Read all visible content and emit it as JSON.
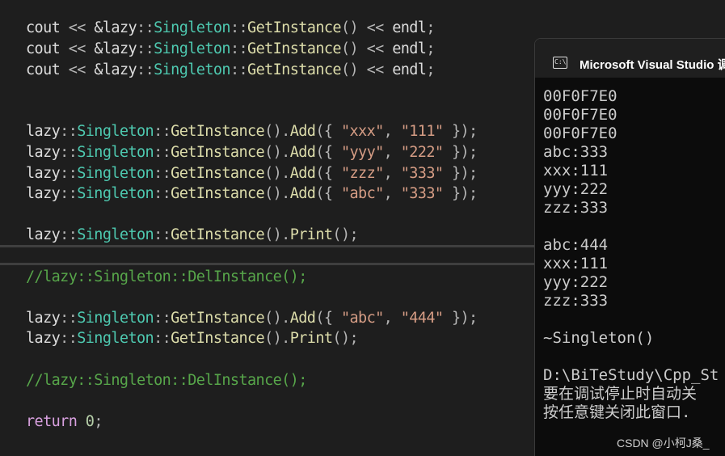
{
  "editor": {
    "lines": [
      {
        "tokens": [
          [
            "t-plain",
            "cout "
          ],
          [
            "t-op",
            "<< "
          ],
          [
            "t-plain",
            "&lazy"
          ],
          [
            "t-op",
            "::"
          ],
          [
            "t-class",
            "Singleton"
          ],
          [
            "t-op",
            "::"
          ],
          [
            "t-func",
            "GetInstance"
          ],
          [
            "t-op",
            "() << "
          ],
          [
            "t-plain",
            "endl"
          ],
          [
            "t-op",
            ";"
          ]
        ]
      },
      {
        "tokens": [
          [
            "t-plain",
            "cout "
          ],
          [
            "t-op",
            "<< "
          ],
          [
            "t-plain",
            "&lazy"
          ],
          [
            "t-op",
            "::"
          ],
          [
            "t-class",
            "Singleton"
          ],
          [
            "t-op",
            "::"
          ],
          [
            "t-func",
            "GetInstance"
          ],
          [
            "t-op",
            "() << "
          ],
          [
            "t-plain",
            "endl"
          ],
          [
            "t-op",
            ";"
          ]
        ]
      },
      {
        "tokens": [
          [
            "t-plain",
            "cout "
          ],
          [
            "t-op",
            "<< "
          ],
          [
            "t-plain",
            "&lazy"
          ],
          [
            "t-op",
            "::"
          ],
          [
            "t-class",
            "Singleton"
          ],
          [
            "t-op",
            "::"
          ],
          [
            "t-func",
            "GetInstance"
          ],
          [
            "t-op",
            "() << "
          ],
          [
            "t-plain",
            "endl"
          ],
          [
            "t-op",
            ";"
          ]
        ]
      },
      {
        "tokens": [
          [
            "t-plain",
            "lazy"
          ],
          [
            "t-op",
            "::"
          ],
          [
            "t-class",
            "Singleton"
          ],
          [
            "t-op",
            "::"
          ],
          [
            "t-func",
            "GetInstance"
          ],
          [
            "t-op",
            "()."
          ],
          [
            "t-func",
            "Add"
          ],
          [
            "t-op",
            "({ "
          ],
          [
            "t-str",
            "\"xxx\""
          ],
          [
            "t-op",
            ", "
          ],
          [
            "t-str",
            "\"111\""
          ],
          [
            "t-op",
            " });"
          ]
        ]
      },
      {
        "tokens": [
          [
            "t-plain",
            "lazy"
          ],
          [
            "t-op",
            "::"
          ],
          [
            "t-class",
            "Singleton"
          ],
          [
            "t-op",
            "::"
          ],
          [
            "t-func",
            "GetInstance"
          ],
          [
            "t-op",
            "()."
          ],
          [
            "t-func",
            "Add"
          ],
          [
            "t-op",
            "({ "
          ],
          [
            "t-str",
            "\"yyy\""
          ],
          [
            "t-op",
            ", "
          ],
          [
            "t-str",
            "\"222\""
          ],
          [
            "t-op",
            " });"
          ]
        ]
      },
      {
        "tokens": [
          [
            "t-plain",
            "lazy"
          ],
          [
            "t-op",
            "::"
          ],
          [
            "t-class",
            "Singleton"
          ],
          [
            "t-op",
            "::"
          ],
          [
            "t-func",
            "GetInstance"
          ],
          [
            "t-op",
            "()."
          ],
          [
            "t-func",
            "Add"
          ],
          [
            "t-op",
            "({ "
          ],
          [
            "t-str",
            "\"zzz\""
          ],
          [
            "t-op",
            ", "
          ],
          [
            "t-str",
            "\"333\""
          ],
          [
            "t-op",
            " });"
          ]
        ]
      },
      {
        "tokens": [
          [
            "t-plain",
            "lazy"
          ],
          [
            "t-op",
            "::"
          ],
          [
            "t-class",
            "Singleton"
          ],
          [
            "t-op",
            "::"
          ],
          [
            "t-func",
            "GetInstance"
          ],
          [
            "t-op",
            "()."
          ],
          [
            "t-func",
            "Add"
          ],
          [
            "t-op",
            "({ "
          ],
          [
            "t-str",
            "\"abc\""
          ],
          [
            "t-op",
            ", "
          ],
          [
            "t-str",
            "\"333\""
          ],
          [
            "t-op",
            " });"
          ]
        ]
      },
      {
        "tokens": [
          [
            "t-plain",
            "lazy"
          ],
          [
            "t-op",
            "::"
          ],
          [
            "t-class",
            "Singleton"
          ],
          [
            "t-op",
            "::"
          ],
          [
            "t-func",
            "GetInstance"
          ],
          [
            "t-op",
            "()."
          ],
          [
            "t-func",
            "Print"
          ],
          [
            "t-op",
            "();"
          ]
        ]
      },
      {
        "tokens": [
          [
            "t-comment",
            "//lazy::Singleton::DelInstance();"
          ]
        ]
      },
      {
        "tokens": [
          [
            "t-plain",
            "lazy"
          ],
          [
            "t-op",
            "::"
          ],
          [
            "t-class",
            "Singleton"
          ],
          [
            "t-op",
            "::"
          ],
          [
            "t-func",
            "GetInstance"
          ],
          [
            "t-op",
            "()."
          ],
          [
            "t-func",
            "Add"
          ],
          [
            "t-op",
            "({ "
          ],
          [
            "t-str",
            "\"abc\""
          ],
          [
            "t-op",
            ", "
          ],
          [
            "t-str",
            "\"444\""
          ],
          [
            "t-op",
            " });"
          ]
        ]
      },
      {
        "tokens": [
          [
            "t-plain",
            "lazy"
          ],
          [
            "t-op",
            "::"
          ],
          [
            "t-class",
            "Singleton"
          ],
          [
            "t-op",
            "::"
          ],
          [
            "t-func",
            "GetInstance"
          ],
          [
            "t-op",
            "()."
          ],
          [
            "t-func",
            "Print"
          ],
          [
            "t-op",
            "();"
          ]
        ]
      },
      {
        "tokens": [
          [
            "t-comment",
            "//lazy::Singleton::DelInstance();"
          ]
        ]
      },
      {
        "tokens": [
          [
            "t-kw",
            "return "
          ],
          [
            "t-num",
            "0"
          ],
          [
            "t-op",
            ";"
          ]
        ]
      }
    ]
  },
  "console": {
    "icon_text": "C:\\",
    "title": "Microsoft Visual Studio 调",
    "output_lines": [
      "00F0F7E0",
      "00F0F7E0",
      "00F0F7E0",
      "abc:333",
      "xxx:111",
      "yyy:222",
      "zzz:333",
      "",
      "abc:444",
      "xxx:111",
      "yyy:222",
      "zzz:333",
      "",
      "~Singleton()",
      "",
      "D:\\BiTeStudy\\Cpp_St",
      "要在调试停止时自动关",
      "按任意键关闭此窗口."
    ]
  },
  "watermark": "CSDN @小柯J桑_"
}
